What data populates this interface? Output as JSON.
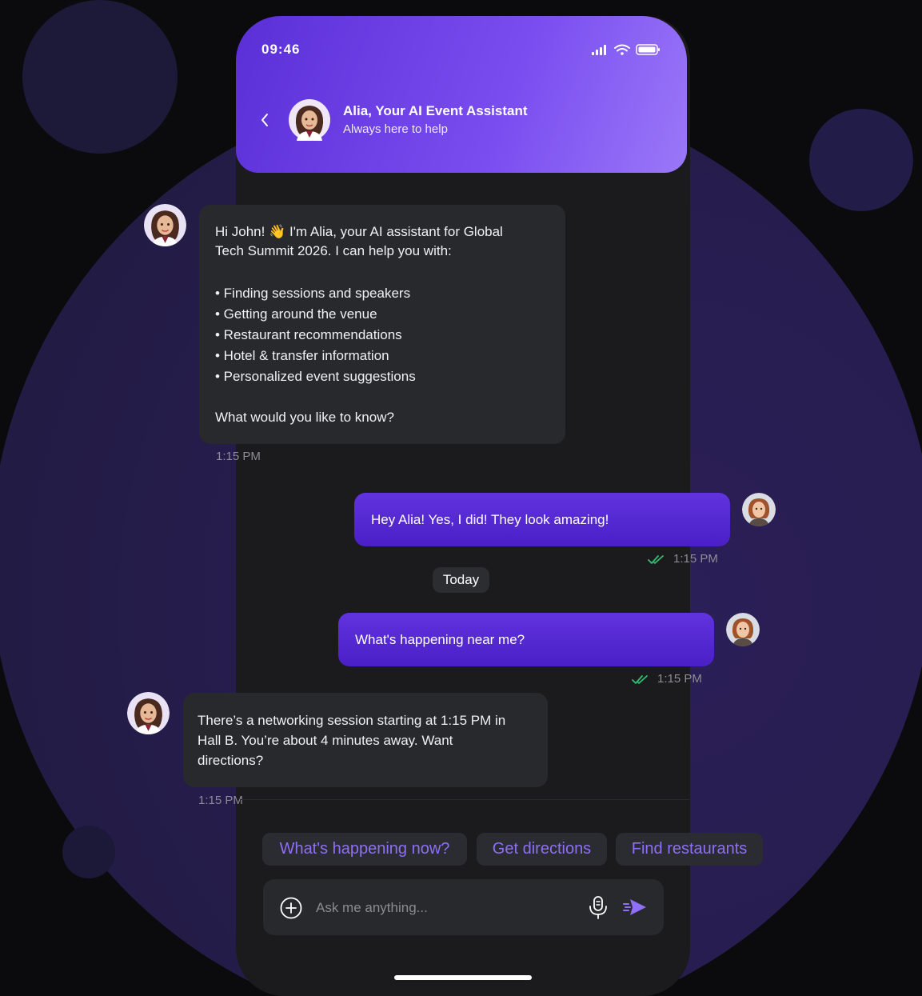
{
  "status_bar": {
    "time": "09:46"
  },
  "header": {
    "title": "Alia, Your AI Event Assistant",
    "subtitle": "Always here to help"
  },
  "messages": [
    {
      "sender": "assistant",
      "lines": [
        "Hi John! 👋 I'm Alia, your AI assistant for Global",
        "Tech Summit 2026. I can help you with:",
        "",
        "• Finding sessions and speakers",
        "• Getting around the venue",
        "• Restaurant recommendations",
        "• Hotel & transfer information",
        "• Personalized event suggestions",
        "",
        "What would you like to know?"
      ],
      "time": "1:15 PM"
    },
    {
      "sender": "user",
      "text": "Hey Alia! Yes, I did! They look amazing!",
      "time": "1:15 PM"
    },
    {
      "sender": "user",
      "text": "What's happening near me?",
      "time": "1:15 PM"
    },
    {
      "sender": "assistant",
      "lines": [
        "There’s a networking session starting at 1:15 PM in",
        "Hall B. You’re about 4 minutes away. Want",
        "directions?"
      ],
      "time": "1:15 PM"
    }
  ],
  "date_separator": "Today",
  "quick_replies": [
    "What's happening now?",
    "Get directions",
    "Find restaurants"
  ],
  "composer": {
    "placeholder": "Ask me anything...",
    "value": ""
  },
  "colors": {
    "accent": "#5a2fd6",
    "accent_light": "#9a78f8",
    "chip_text": "#8f6ff5",
    "read_check": "#2fbf71"
  },
  "icons": [
    "signal-icon",
    "wifi-icon",
    "battery-icon",
    "back-chevron-icon",
    "add-icon",
    "microphone-icon",
    "send-icon",
    "double-check-icon"
  ]
}
